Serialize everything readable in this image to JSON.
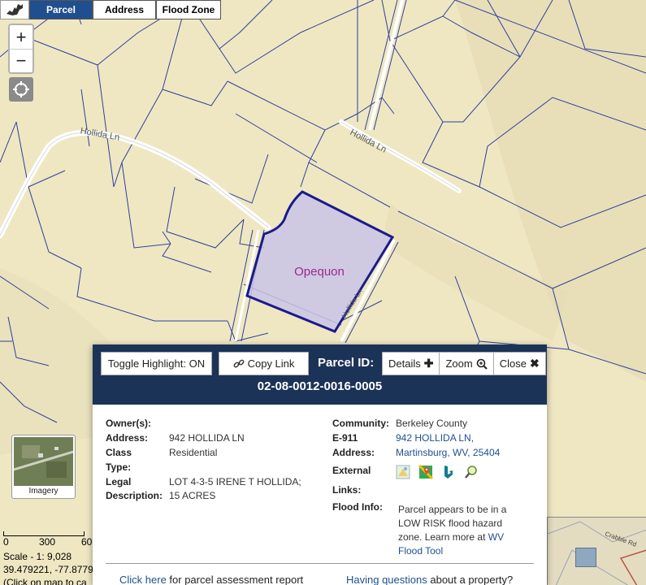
{
  "toolbar": {
    "tabs": [
      {
        "label": "Parcel",
        "active": true
      },
      {
        "label": "Address",
        "active": false
      },
      {
        "label": "Flood Zone",
        "active": false
      }
    ]
  },
  "map": {
    "zoom_in": "+",
    "zoom_out": "−",
    "parcel_label": "Opequon",
    "roads": [
      "Hollida Ln",
      "Hollida Ln",
      "Hollida Ln",
      "Crabble Rd"
    ],
    "imagery_label": "Imagery",
    "scale_ticks": [
      "0",
      "300",
      "60"
    ],
    "scale_text": "Scale - 1: 9,028",
    "coords_text": "39.479221, -77.8779",
    "click_hint": "(Click on map to ca",
    "colors": {
      "map_background": "#efe7c2",
      "parcel_lines": "#2f3f9c",
      "selected_fill": "#c9c4e6",
      "selected_stroke": "#1b1a8e",
      "roads": "#ffffff"
    }
  },
  "popup": {
    "toggle_highlight": "Toggle Highlight: ON",
    "copy_link": "Copy Link",
    "parcel_id_label": "Parcel ID:",
    "details": "Details",
    "zoom": "Zoom",
    "close": "Close",
    "parcel_id": "02-08-0012-0016-0005",
    "left": {
      "owner_label": "Owner(s):",
      "address_label": "Address:",
      "address_value": "942 HOLLIDA LN",
      "class_label": "Class",
      "class_value": "Residential",
      "type_label": "Type:",
      "legal_label": "Legal",
      "description_label": "Description:",
      "legal_value_1": "LOT 4-3-5 IRENE T HOLLIDA;",
      "legal_value_2": "15 ACRES"
    },
    "right": {
      "community_label": "Community:",
      "community_value": "Berkeley County",
      "e911_label": "E-911",
      "e911_address_label": "Address:",
      "e911_line1": "942 HOLLIDA LN,",
      "e911_line2": "Martinsburg, WV, 25404",
      "external_label": "External",
      "links_label": "Links:",
      "flood_label": "Flood Info:",
      "flood_text_1": "Parcel appears to be in a",
      "flood_text_2": "LOW RISK flood hazard",
      "flood_text_3": "zone. Learn more at",
      "flood_link_1": "WV",
      "flood_link_2": "Flood Tool",
      "external_icons": [
        "streetview-icon",
        "google-maps-icon",
        "bing-icon",
        "search-icon"
      ]
    },
    "footer": {
      "left_link": "Click here",
      "left_text": "for parcel assessment report",
      "right_link": "Having questions",
      "right_text": "about a property?"
    }
  }
}
